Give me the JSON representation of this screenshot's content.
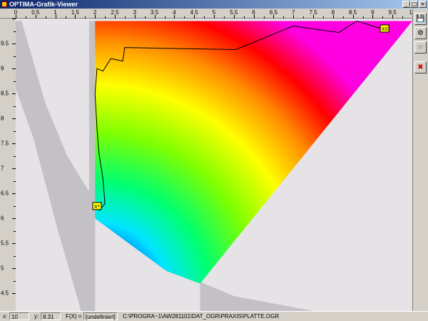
{
  "window": {
    "title": "OPTIMA-Grafik-Viewer",
    "minimize": "_",
    "maximize": "□",
    "close": "×"
  },
  "axes": {
    "x_ticks": [
      "0",
      "0.5",
      "1",
      "1.5",
      "2",
      "2.5",
      "3",
      "3.5",
      "4",
      "4.5",
      "5",
      "5.5",
      "6",
      "6.5",
      "7",
      "7.5",
      "8",
      "8.5",
      "9",
      "9.5",
      "10"
    ],
    "y_ticks": [
      "9.5",
      "9",
      "8.5",
      "8",
      "7.5",
      "7",
      "6.5",
      "6",
      "5.5",
      "5",
      "4.5"
    ],
    "xlim": [
      0,
      10
    ],
    "ylim": [
      4.15,
      10
    ]
  },
  "chart_data": {
    "type": "heatmap",
    "xlim": [
      0,
      10
    ],
    "ylim": [
      4.15,
      10
    ],
    "colors": {
      "background": "#e6e3e6",
      "infeasible": "#c3c1c5",
      "path": "#000000"
    },
    "feasible_region": [
      [
        2.0,
        9.95
      ],
      [
        10.0,
        9.95
      ],
      [
        4.65,
        4.7
      ],
      [
        3.8,
        4.95
      ],
      [
        2.0,
        6.0
      ]
    ],
    "infeasible_regions": [
      [
        [
          0.15,
          9.95
        ],
        [
          0.75,
          8.3
        ],
        [
          1.3,
          7.25
        ],
        [
          2.0,
          6.35
        ],
        [
          2.0,
          4.15
        ],
        [
          1.65,
          4.15
        ],
        [
          1.05,
          5.8
        ],
        [
          0.45,
          7.6
        ],
        [
          0.0,
          8.6
        ],
        [
          0.0,
          9.95
        ]
      ],
      [
        [
          2.0,
          9.95
        ],
        [
          2.0,
          4.15
        ],
        [
          1.85,
          4.15
        ],
        [
          1.85,
          9.95
        ]
      ],
      [
        [
          4.65,
          4.15
        ],
        [
          4.65,
          4.7
        ],
        [
          3.8,
          4.95
        ],
        [
          2.0,
          6.0
        ],
        [
          2.2,
          5.95
        ],
        [
          3.6,
          5.1
        ],
        [
          4.6,
          4.75
        ],
        [
          5.5,
          4.45
        ],
        [
          7.5,
          4.15
        ]
      ]
    ],
    "path": {
      "x": [
        9.2,
        8.6,
        8.5,
        8.15,
        7.0,
        5.55,
        2.75,
        2.7,
        2.4,
        2.2,
        2.05,
        2.0,
        2.05,
        2.1,
        2.2,
        2.25,
        2.1
      ],
      "y": [
        9.8,
        9.95,
        9.9,
        9.72,
        9.85,
        9.38,
        9.42,
        9.15,
        9.2,
        8.95,
        9.0,
        8.5,
        7.8,
        7.3,
        6.8,
        6.3,
        6.15
      ]
    },
    "markers": [
      {
        "label": "X0",
        "x": 9.3,
        "y": 9.8
      },
      {
        "label": "X*",
        "x": 2.05,
        "y": 6.25
      }
    ]
  },
  "toolbar": {
    "save_icon": "💾",
    "settings_icon": "⚙",
    "layers_icon": "≋",
    "close_icon": "✖"
  },
  "status": {
    "x_label": "x:",
    "x_value": "10",
    "y_label": "y:",
    "y_value": "8.31",
    "f_label": "F(X) =",
    "f_value": "[undefiniert]",
    "path": "C:\\PROGRA~1\\AW281101\\DAT_OGR\\PRAXIS\\PLATTE.OGR"
  }
}
